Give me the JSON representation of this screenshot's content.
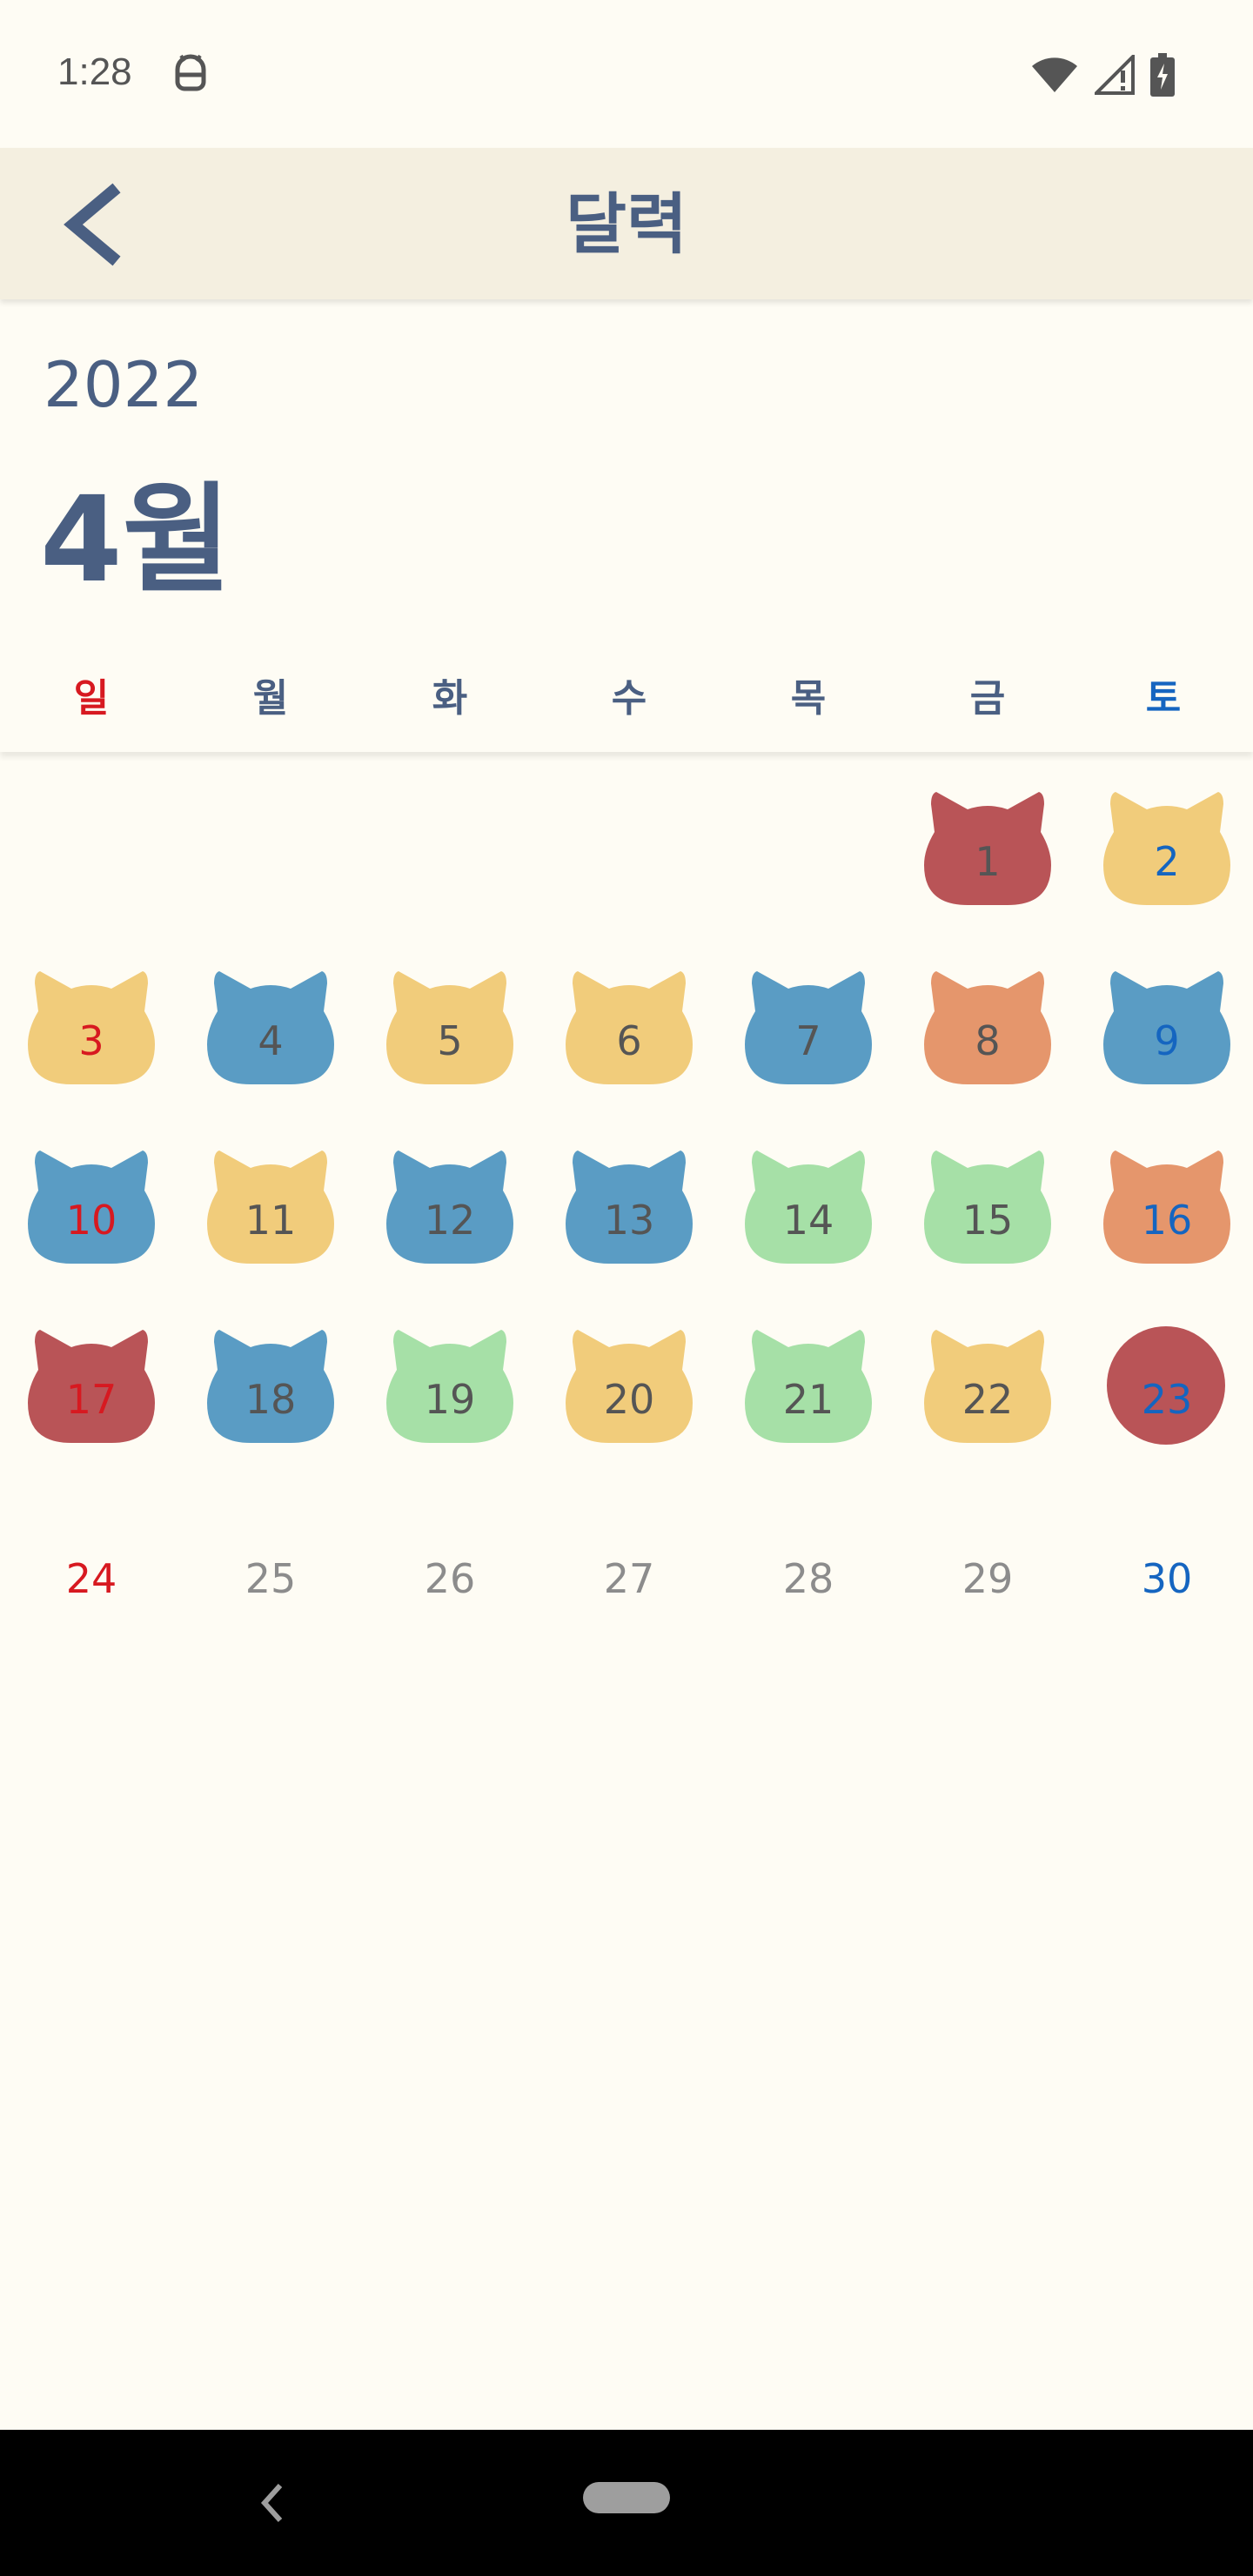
{
  "status": {
    "time": "1:28",
    "icons": [
      "android-debug-icon",
      "wifi-icon",
      "cell-signal-icon",
      "battery-charging-icon"
    ]
  },
  "app_bar": {
    "title": "달력",
    "back_icon": "chevron-left-icon"
  },
  "calendar": {
    "year": "2022",
    "month": "4월",
    "weekdays": [
      "일",
      "월",
      "화",
      "수",
      "목",
      "금",
      "토"
    ],
    "colors": {
      "red": "#b95457",
      "yellow": "#f1cc7b",
      "blue": "#5a9cc4",
      "orange": "#e5966c",
      "green": "#a6e0a7",
      "sunday": "#d71920",
      "saturday": "#1565c0",
      "text": "#4a5f82"
    },
    "days": [
      {
        "day": "1",
        "col": 5,
        "row": 0,
        "mood": "red",
        "shape": "cat"
      },
      {
        "day": "2",
        "col": 6,
        "row": 0,
        "mood": "yellow",
        "shape": "cat"
      },
      {
        "day": "3",
        "col": 0,
        "row": 1,
        "mood": "yellow",
        "shape": "cat"
      },
      {
        "day": "4",
        "col": 1,
        "row": 1,
        "mood": "blue",
        "shape": "cat"
      },
      {
        "day": "5",
        "col": 2,
        "row": 1,
        "mood": "yellow",
        "shape": "cat"
      },
      {
        "day": "6",
        "col": 3,
        "row": 1,
        "mood": "yellow",
        "shape": "cat"
      },
      {
        "day": "7",
        "col": 4,
        "row": 1,
        "mood": "blue",
        "shape": "cat"
      },
      {
        "day": "8",
        "col": 5,
        "row": 1,
        "mood": "orange",
        "shape": "cat"
      },
      {
        "day": "9",
        "col": 6,
        "row": 1,
        "mood": "blue",
        "shape": "cat"
      },
      {
        "day": "10",
        "col": 0,
        "row": 2,
        "mood": "blue",
        "shape": "cat"
      },
      {
        "day": "11",
        "col": 1,
        "row": 2,
        "mood": "yellow",
        "shape": "cat"
      },
      {
        "day": "12",
        "col": 2,
        "row": 2,
        "mood": "blue",
        "shape": "cat"
      },
      {
        "day": "13",
        "col": 3,
        "row": 2,
        "mood": "blue",
        "shape": "cat"
      },
      {
        "day": "14",
        "col": 4,
        "row": 2,
        "mood": "green",
        "shape": "cat"
      },
      {
        "day": "15",
        "col": 5,
        "row": 2,
        "mood": "green",
        "shape": "cat"
      },
      {
        "day": "16",
        "col": 6,
        "row": 2,
        "mood": "orange",
        "shape": "cat"
      },
      {
        "day": "17",
        "col": 0,
        "row": 3,
        "mood": "red",
        "shape": "cat"
      },
      {
        "day": "18",
        "col": 1,
        "row": 3,
        "mood": "blue",
        "shape": "cat"
      },
      {
        "day": "19",
        "col": 2,
        "row": 3,
        "mood": "green",
        "shape": "cat"
      },
      {
        "day": "20",
        "col": 3,
        "row": 3,
        "mood": "yellow",
        "shape": "cat"
      },
      {
        "day": "21",
        "col": 4,
        "row": 3,
        "mood": "green",
        "shape": "cat"
      },
      {
        "day": "22",
        "col": 5,
        "row": 3,
        "mood": "yellow",
        "shape": "cat"
      },
      {
        "day": "23",
        "col": 6,
        "row": 3,
        "mood": "red",
        "shape": "circle"
      },
      {
        "day": "24",
        "col": 0,
        "row": 4,
        "mood": null,
        "shape": "none"
      },
      {
        "day": "25",
        "col": 1,
        "row": 4,
        "mood": null,
        "shape": "none"
      },
      {
        "day": "26",
        "col": 2,
        "row": 4,
        "mood": null,
        "shape": "none"
      },
      {
        "day": "27",
        "col": 3,
        "row": 4,
        "mood": null,
        "shape": "none"
      },
      {
        "day": "28",
        "col": 4,
        "row": 4,
        "mood": null,
        "shape": "none"
      },
      {
        "day": "29",
        "col": 5,
        "row": 4,
        "mood": null,
        "shape": "none"
      },
      {
        "day": "30",
        "col": 6,
        "row": 4,
        "mood": null,
        "shape": "none"
      }
    ]
  },
  "nav": {
    "back_icon": "nav-back-icon",
    "home_icon": "nav-home-pill"
  }
}
